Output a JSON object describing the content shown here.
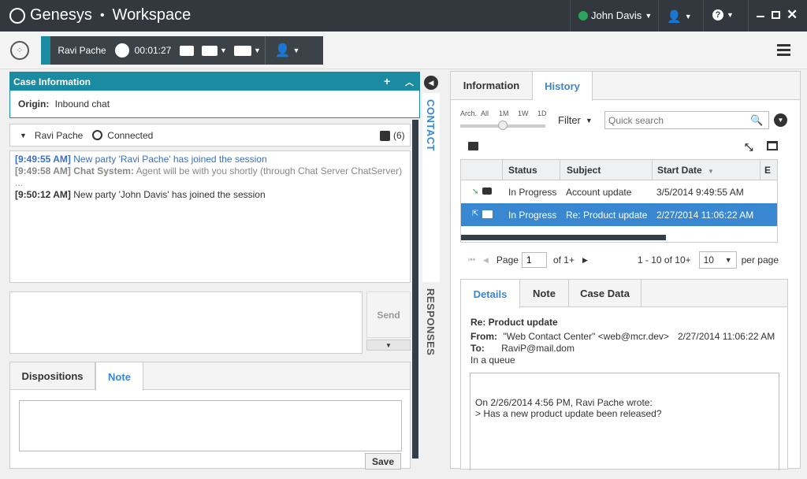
{
  "topbar": {
    "brand": "Genesys",
    "app": "Workspace",
    "user": "John Davis",
    "status_color": "#29a55c"
  },
  "callbar": {
    "contact": "Ravi Pache",
    "timer": "00:01:27"
  },
  "case": {
    "header": "Case Information",
    "origin_label": "Origin:",
    "origin_value": "Inbound chat"
  },
  "chat": {
    "party": "Ravi Pache",
    "status": "Connected",
    "count": "(6)",
    "messages": [
      {
        "time": "[9:49:55 AM]",
        "text": "New party 'Ravi Pache' has joined the session",
        "color": "#3a6fc4"
      },
      {
        "time": "[9:49:58 AM]",
        "sender": "Chat System:",
        "text": "Agent will be with you shortly (through Chat Server ChatServer) ...",
        "color": "#888888"
      },
      {
        "time": "[9:50:12 AM]",
        "text": "New party 'John Davis' has joined the session",
        "color": "#333333"
      }
    ],
    "send_label": "Send"
  },
  "bottom_tabs": {
    "dispositions": "Dispositions",
    "note": "Note",
    "save_label": "Save"
  },
  "side_tabs": {
    "contact": "CONTACT",
    "responses": "RESPONSES"
  },
  "right": {
    "tabs": [
      "Information",
      "History"
    ],
    "slider_labels": [
      "Arch.",
      "All",
      "1M",
      "1W",
      "1D"
    ],
    "filter_label": "Filter",
    "search_placeholder": "Quick search",
    "columns": [
      "Status",
      "Subject",
      "Start Date",
      "E"
    ],
    "rows": [
      {
        "status": "In Progress",
        "subject": "Account update",
        "date": "3/5/2014 9:49:55 AM"
      },
      {
        "status": "In Progress",
        "subject": "Re: Product update",
        "date": "2/27/2014 11:06:22 AM"
      }
    ],
    "pager": {
      "page_label": "Page",
      "page_value": "1",
      "of_label": "of 1+",
      "range": "1 - 10 of 10+",
      "per_page_value": "10",
      "per_page_label": "per page"
    },
    "detail_tabs": [
      "Details",
      "Note",
      "Case Data"
    ],
    "detail": {
      "subject": "Re: Product update",
      "from_label": "From:",
      "from_value": "\"Web Contact Center\" <web@mcr.dev>",
      "date": "2/27/2014 11:06:22 AM",
      "to_label": "To:",
      "to_value": "RaviP@mail.dom",
      "queue": "In a queue",
      "body_line1": "On 2/26/2014 4:56 PM, Ravi Pache wrote:",
      "body_line2": "> Has a new product update been released?"
    }
  }
}
